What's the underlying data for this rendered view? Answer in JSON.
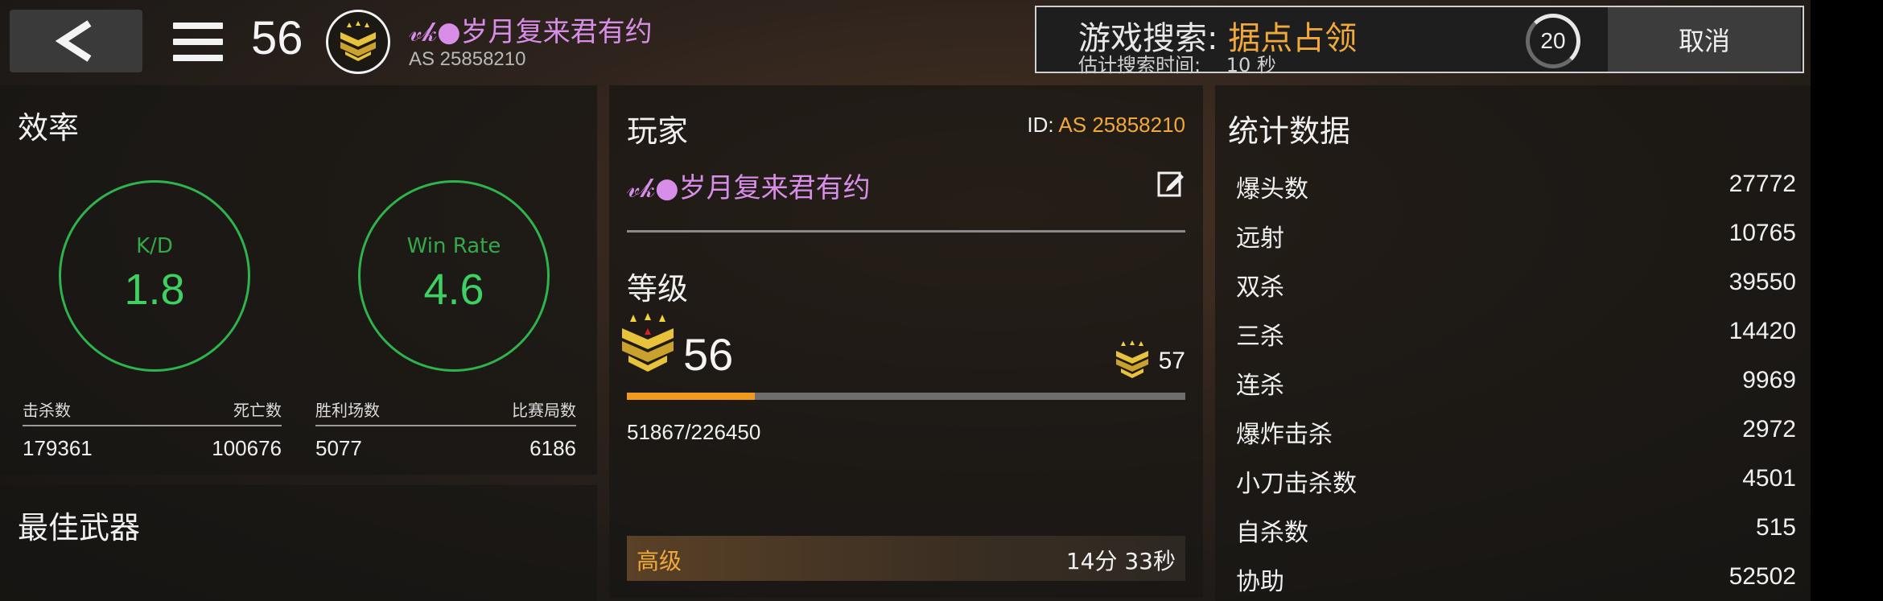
{
  "header": {
    "level": "56",
    "player_name": "𝓋𝓀●岁月复来君有约",
    "player_as": "AS 25858210"
  },
  "search": {
    "label": "游戏搜索:",
    "mode": "据点占领",
    "time_label": "估计搜索时间:",
    "time_value": "10 秒",
    "countdown": "20",
    "cancel_label": "取消"
  },
  "efficiency": {
    "title": "效率",
    "kd_label": "K/D",
    "kd_value": "1.8",
    "winrate_label": "Win Rate",
    "winrate_value": "4.6",
    "kills_label": "击杀数",
    "kills_value": "179361",
    "deaths_label": "死亡数",
    "deaths_value": "100676",
    "wins_label": "胜利场数",
    "wins_value": "5077",
    "matches_label": "比赛局数",
    "matches_value": "6186"
  },
  "best_weapon": {
    "title": "最佳武器"
  },
  "player": {
    "title": "玩家",
    "id_prefix": "ID:",
    "id_value": "AS 25858210",
    "name": "𝓋𝓀●岁月复来君有约",
    "rank_title": "等级",
    "level": "56",
    "next_level": "57",
    "xp_text": "51867/226450",
    "xp_progress": 0.229,
    "tier_name": "高级",
    "tier_time": "14分 33秒"
  },
  "stats": {
    "title": "统计数据",
    "rows": [
      {
        "label": "爆头数",
        "value": "27772"
      },
      {
        "label": "远射",
        "value": "10765"
      },
      {
        "label": "双杀",
        "value": "39550"
      },
      {
        "label": "三杀",
        "value": "14420"
      },
      {
        "label": "连杀",
        "value": "9969"
      },
      {
        "label": "爆炸击杀",
        "value": "2972"
      },
      {
        "label": "小刀击杀数",
        "value": "4501"
      },
      {
        "label": "自杀数",
        "value": "515"
      },
      {
        "label": "协助",
        "value": "52502"
      }
    ]
  },
  "colors": {
    "accent_orange": "#f0a93a",
    "name_purple": "#d88ee8",
    "ring_green": "#2fb34d"
  },
  "icons": {
    "back": "chevron-left-icon",
    "menu": "hamburger-menu-icon",
    "rank": "rank-chevron-badge-icon",
    "edit": "edit-pencil-icon"
  }
}
